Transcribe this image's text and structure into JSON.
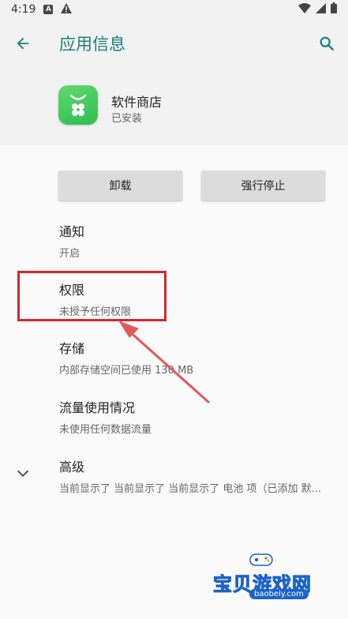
{
  "status_bar": {
    "time": "4:19",
    "a_icon_label": "A"
  },
  "app_bar": {
    "title": "应用信息"
  },
  "app": {
    "name": "软件商店",
    "status": "已安装"
  },
  "buttons": {
    "uninstall": "卸载",
    "force_stop": "强行停止"
  },
  "items": [
    {
      "title": "通知",
      "subtitle": "开启"
    },
    {
      "title": "权限",
      "subtitle": "未授予任何权限"
    },
    {
      "title": "存储",
      "subtitle": "内部存储空间已使用 130 MB"
    },
    {
      "title": "流量使用情况",
      "subtitle": "未使用任何数据流量"
    },
    {
      "title": "高级",
      "subtitle": "当前显示了 当前显示了 当前显示了 电池 项（已添加 默..."
    }
  ],
  "watermark": {
    "text": "宝贝游戏网",
    "url": "baobeiy.com"
  },
  "colors": {
    "accent": "#1a7f7a",
    "highlight": "#d6262b",
    "app_icon": "#3cc95a"
  }
}
